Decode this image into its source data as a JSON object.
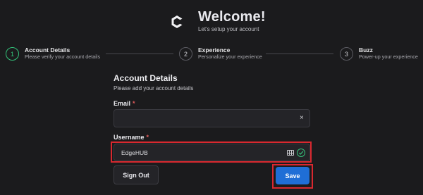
{
  "header": {
    "title": "Welcome!",
    "subtitle": "Let's setup your account",
    "logo_icon": "edge-c-logo-icon"
  },
  "stepper": {
    "steps": [
      {
        "number": "1",
        "title": "Account Details",
        "subtitle": "Please verify your account details",
        "active": true
      },
      {
        "number": "2",
        "title": "Experience",
        "subtitle": "Personalize your experience",
        "active": false
      },
      {
        "number": "3",
        "title": "Buzz",
        "subtitle": "Power-up your experience",
        "active": false
      }
    ]
  },
  "form": {
    "title": "Account Details",
    "subtitle": "Please add your account details",
    "email": {
      "label": "Email",
      "required_mark": "*",
      "value": "",
      "clear_icon": "×"
    },
    "username": {
      "label": "Username",
      "required_mark": "*",
      "value": "EdgeHUB"
    }
  },
  "actions": {
    "sign_out_label": "Sign Out",
    "save_label": "Save"
  },
  "colors": {
    "background": "#1b1b1d",
    "accent_green": "#33c37a",
    "primary_blue": "#1f6ed6",
    "highlight_red": "#d8282f"
  }
}
